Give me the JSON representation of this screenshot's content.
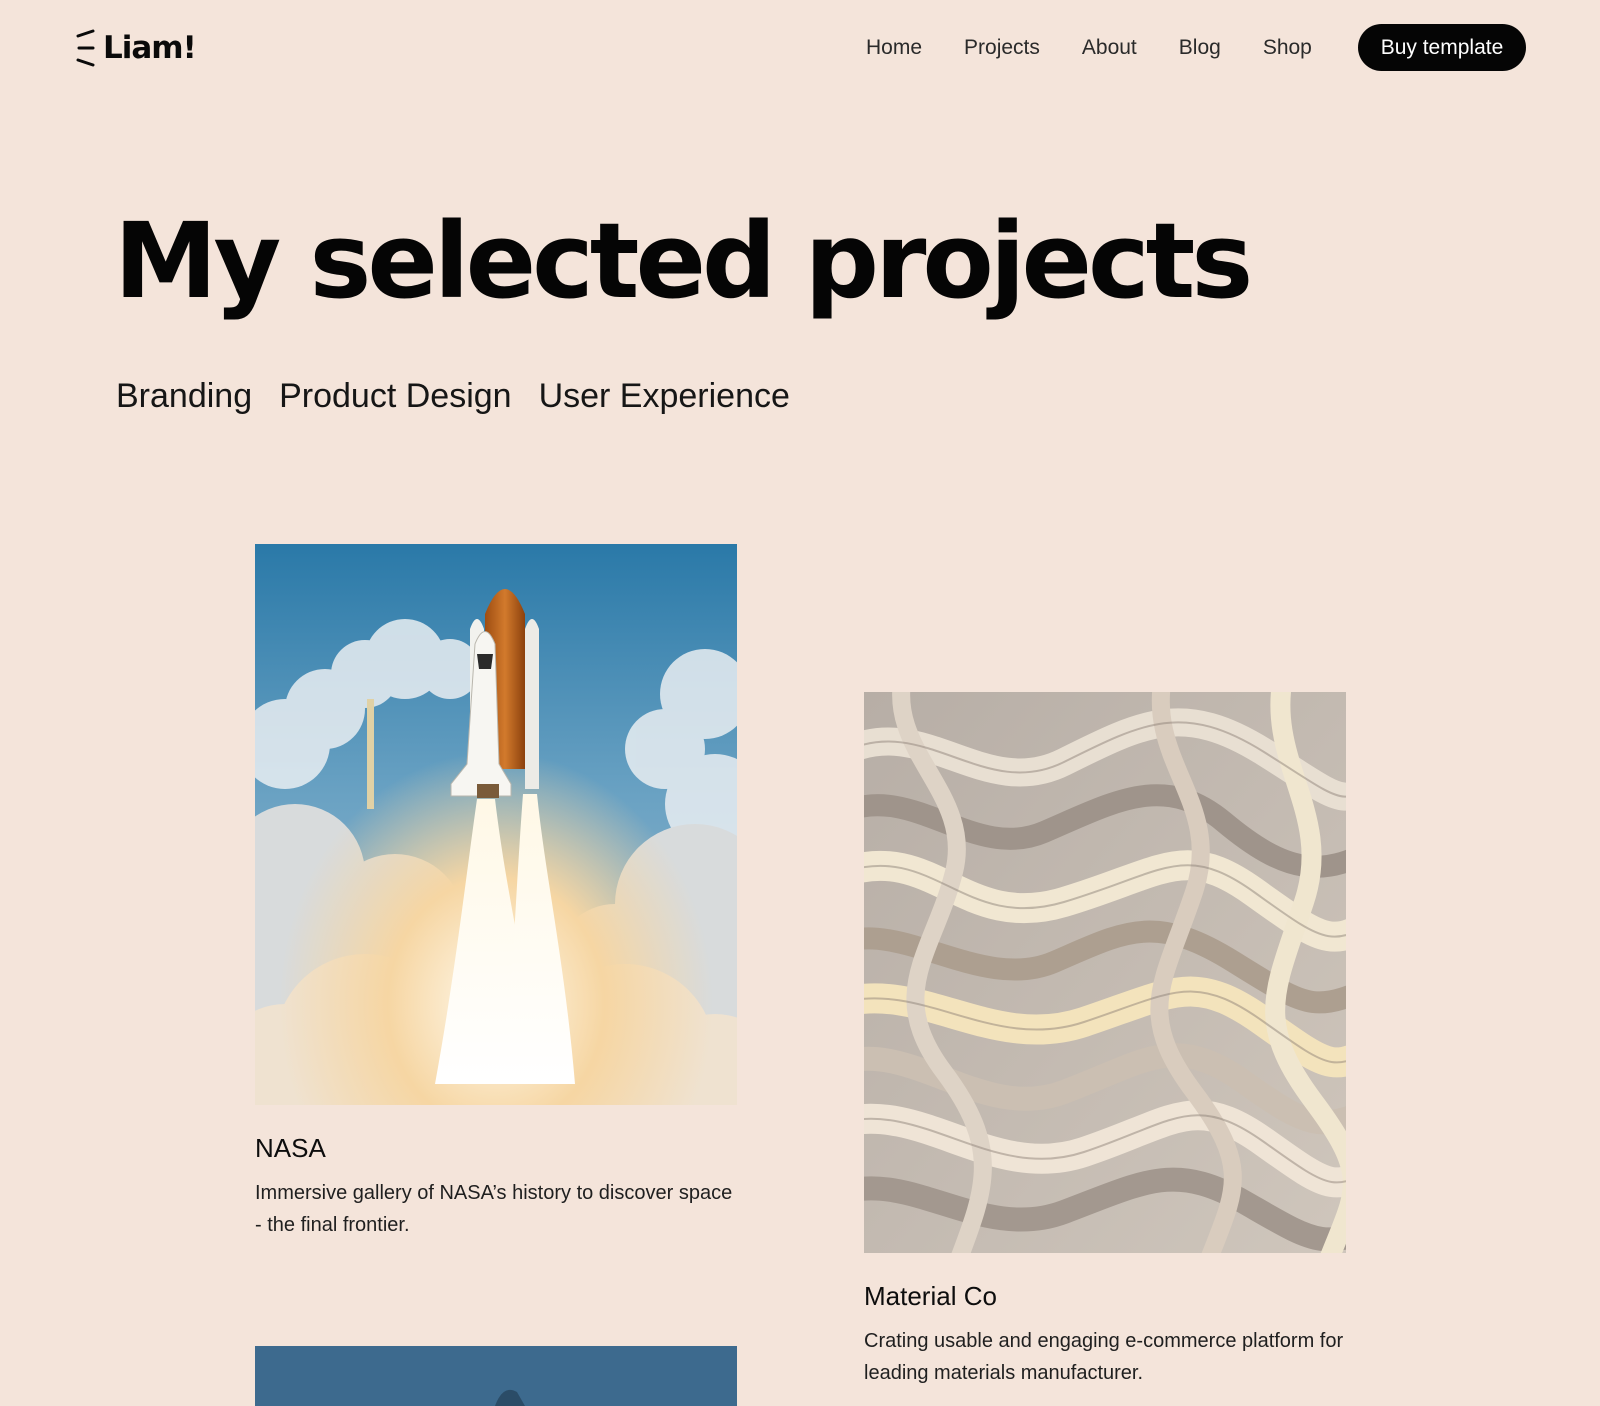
{
  "brand": {
    "name": "Liam!"
  },
  "nav": {
    "items": [
      {
        "label": "Home"
      },
      {
        "label": "Projects"
      },
      {
        "label": "About"
      },
      {
        "label": "Blog"
      },
      {
        "label": "Shop"
      }
    ],
    "cta_label": "Buy template"
  },
  "hero": {
    "title": "My selected projects",
    "categories": [
      "Branding",
      "Product Design",
      "User Experience"
    ]
  },
  "projects": [
    {
      "title": "NASA",
      "description": "Immersive gallery of NASA’s history to discover space - the final frontier.",
      "image": "rocket-launch-image"
    },
    {
      "title": "Material Co",
      "description": "Crating usable and engaging e-commerce platform for leading materials manufacturer.",
      "image": "abstract-folded-material-image"
    },
    {
      "image": "partial-project-image"
    }
  ],
  "colors": {
    "background": "#f4e4da",
    "text": "#0a0a0a",
    "button": "#050505",
    "button_text": "#ffffff"
  }
}
